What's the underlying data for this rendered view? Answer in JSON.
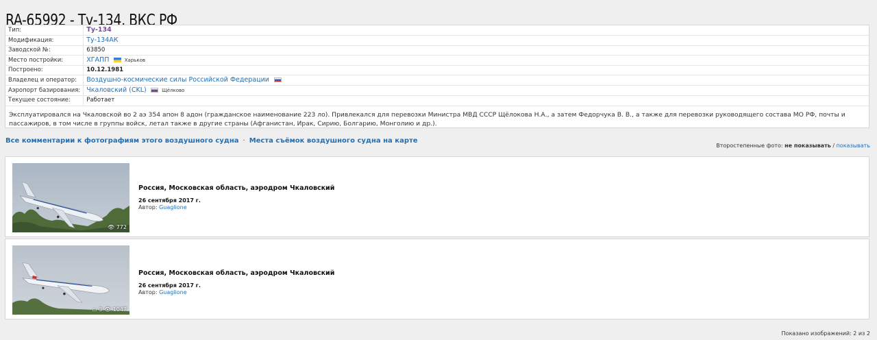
{
  "title": "RA-65992 - Ту-134, ВКС РФ",
  "info": {
    "type": {
      "label": "Тип:",
      "value": "Ту-134"
    },
    "modification": {
      "label": "Модификация:",
      "value": "Ту-134АК"
    },
    "serial": {
      "label": "Заводской №:",
      "value": "63850"
    },
    "built_place": {
      "label": "Место постройки:",
      "value": "ХГАПП",
      "city": "Харьков"
    },
    "built": {
      "label": "Построено:",
      "value": "10.12.1981"
    },
    "owner": {
      "label": "Владелец и оператор:",
      "value": "Воздушно-космические силы Российской Федерации"
    },
    "airport": {
      "label": "Аэропорт базирования:",
      "value": "Чкаловский (CKL)",
      "city": "Щёлково"
    },
    "status": {
      "label": "Текущее состояние:",
      "value": "Работает"
    },
    "remarks": "Эксплуатировался на Чкаловской во 2 аэ 354 апон 8 адон (гражданское наименование 223 ло). Привлекался для перевозки Министра МВД СССР Щёлокова Н.А., а затем Федорчука В. В., а также для перевозки руководящего состава МО РФ, почты и пассажиров, в том числе в группы войск, летал также в другие страны (Афганистан, Ирак, Сирию, Болгарию, Монголию и др.)."
  },
  "links": {
    "comments": "Все комментарии к фотографиям этого воздушного судна",
    "separator": "·",
    "map": "Места съёмок воздушного судна на карте"
  },
  "secondary": {
    "label": "Второстепенные фото:",
    "hide": "не показывать",
    "slash": "/",
    "show": "показывать"
  },
  "photos": [
    {
      "place": "Россия, Московская область, аэродром Чкаловский",
      "date": "26 сентября 2017 г.",
      "author_label": "Автор:",
      "author": "Guaglione",
      "views": "772",
      "comments": ""
    },
    {
      "place": "Россия, Московская область, аэродром Чкаловский",
      "date": "26 сентября 2017 г.",
      "author_label": "Автор:",
      "author": "Guaglione",
      "views": "1047",
      "comments": "3"
    }
  ],
  "footer": "Показано изображений: 2 из 2",
  "colors": {
    "link": "#1f6fb8",
    "type_link": "#7a4aa0",
    "background": "#efefef"
  },
  "icons": [
    "eye-icon",
    "comment-icon",
    "flag-ua-icon",
    "flag-ru-icon"
  ]
}
